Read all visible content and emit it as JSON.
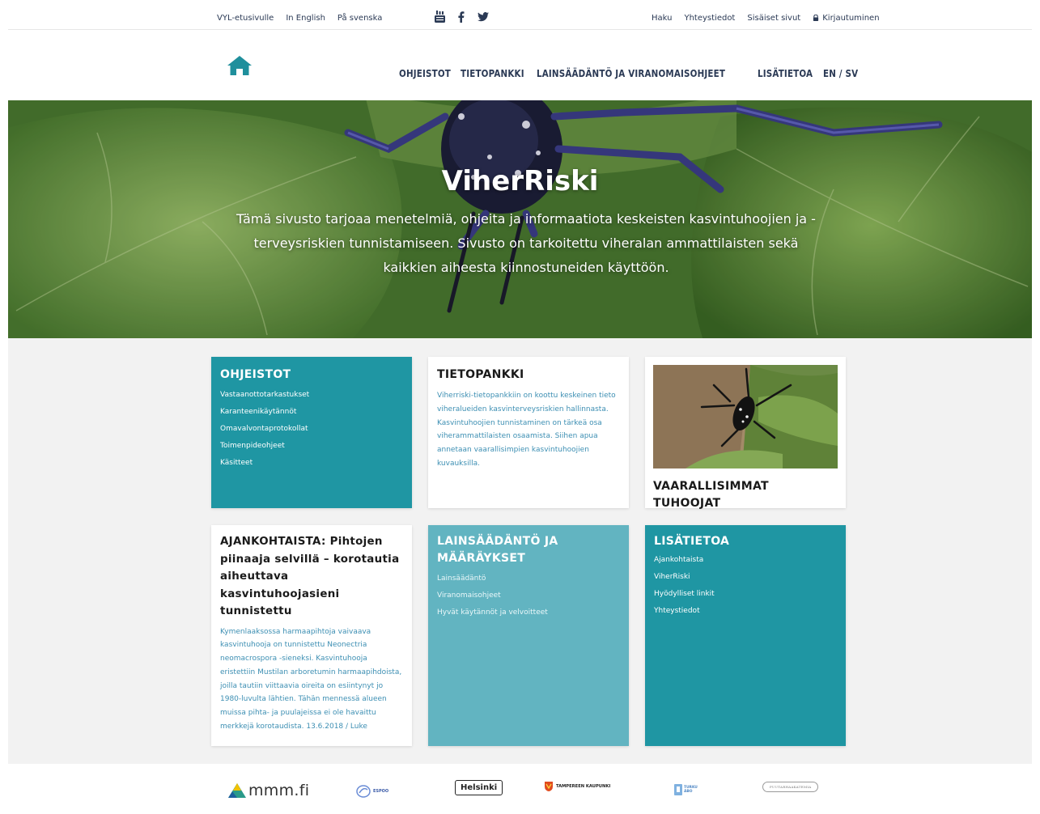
{
  "topbar": {
    "left_links": [
      "VYL-etusivulle",
      "In English",
      "På svenska"
    ],
    "social": [
      {
        "icon": "youtube-icon",
        "glyph": "▣"
      },
      {
        "icon": "facebook-icon",
        "glyph": "f"
      },
      {
        "icon": "twitter-icon",
        "glyph": "🐦"
      }
    ],
    "right_links": [
      "Haku",
      "Yhteystiedot",
      "Sisäiset sivut"
    ],
    "login_label": "Kirjautuminen"
  },
  "nav": {
    "items": [
      "OHJEISTOT",
      "TIETOPANKKI",
      "LAINSÄÄDÄNTÖ JA VIRANOMAISOHJEET",
      "LISÄTIETOA",
      "EN / SV"
    ]
  },
  "hero": {
    "title": "ViherRiski",
    "text": "Tämä sivusto tarjoaa menetelmiä, ohjeita ja informaatiota keskeisten kasvintuhoojien ja -terveysriskien tunnistamiseen. Sivusto on tarkoitettu viheralan ammattilaisten sekä kaikkien aiheesta kiinnostuneiden käyttöön."
  },
  "cards": {
    "ohjeistot": {
      "title": "OHJEISTOT",
      "links": [
        "Vastaanottotarkastukset",
        "Karanteenikäytännöt",
        "Omavalvontaprotokollat",
        "Toimenpideohjeet",
        "Käsitteet"
      ]
    },
    "tietopankki": {
      "title": "TIETOPANKKI",
      "text": "Viherriski-tietopankkiin on koottu keskeinen tieto viheralueiden kasvinterveysriskien hallinnasta. Kasvintuhoojien tunnistaminen on tärkeä osa vihe­rammattilaisten osaamista. Siihen apua annetaan vaarallisimpien kasvintuhoojien kuvauksilla."
    },
    "tuhoojat": {
      "title": "VAARALLISIMMAT TUHOOJAT"
    },
    "ajankohtaista": {
      "title": "AJANKOHTAISTA: Pihtojen piinaaja selvillä – korotautia aiheuttava kasvintuhoojasieni tunnistettu",
      "text": "Kymenlaaksossa harmaapihtoja vaivaava kasvintuhooja on tunnistettu Neonectria neomacrospora -sieneksi. Kasvintuhooja eristettiin Mustilan arboretumin harmaapihdoista, joilla tautiin viittaavia oireita on esiintynyt jo 1980-luvulta lähtien. Tähän mennessä alueen muissa pihta- ja puulajeissa ei ole havaittu merkkejä korotaudista. 13.6.2018 / Luke"
    },
    "lainsaadanto": {
      "title": "LAINSÄÄDÄNTÖ JA MÄÄRÄYKSET",
      "links": [
        "Lainsäädäntö",
        "Viranomaisohjeet",
        "Hyvät käytännöt ja velvoitteet"
      ]
    },
    "lisatietoa": {
      "title": "LISÄTIETOA",
      "links": [
        "Ajankohtaista",
        "ViherRiski",
        "Hyödylliset linkit",
        "Yhteystiedot"
      ]
    }
  },
  "footer": {
    "mmm": "mmm.fi",
    "espoo": "ESPOO",
    "helsinki": "Helsinki",
    "tampere": "TAMPEREEN KAUPUNKI",
    "turku": "TURKU ÅBO",
    "vantaa": "PUUTARHAAKATEMIA"
  },
  "colors": {
    "teal": "#1f96a3",
    "light_teal": "#62b4c1",
    "nav_text": "#2b3a55",
    "link_blue": "#3d8fb3"
  }
}
